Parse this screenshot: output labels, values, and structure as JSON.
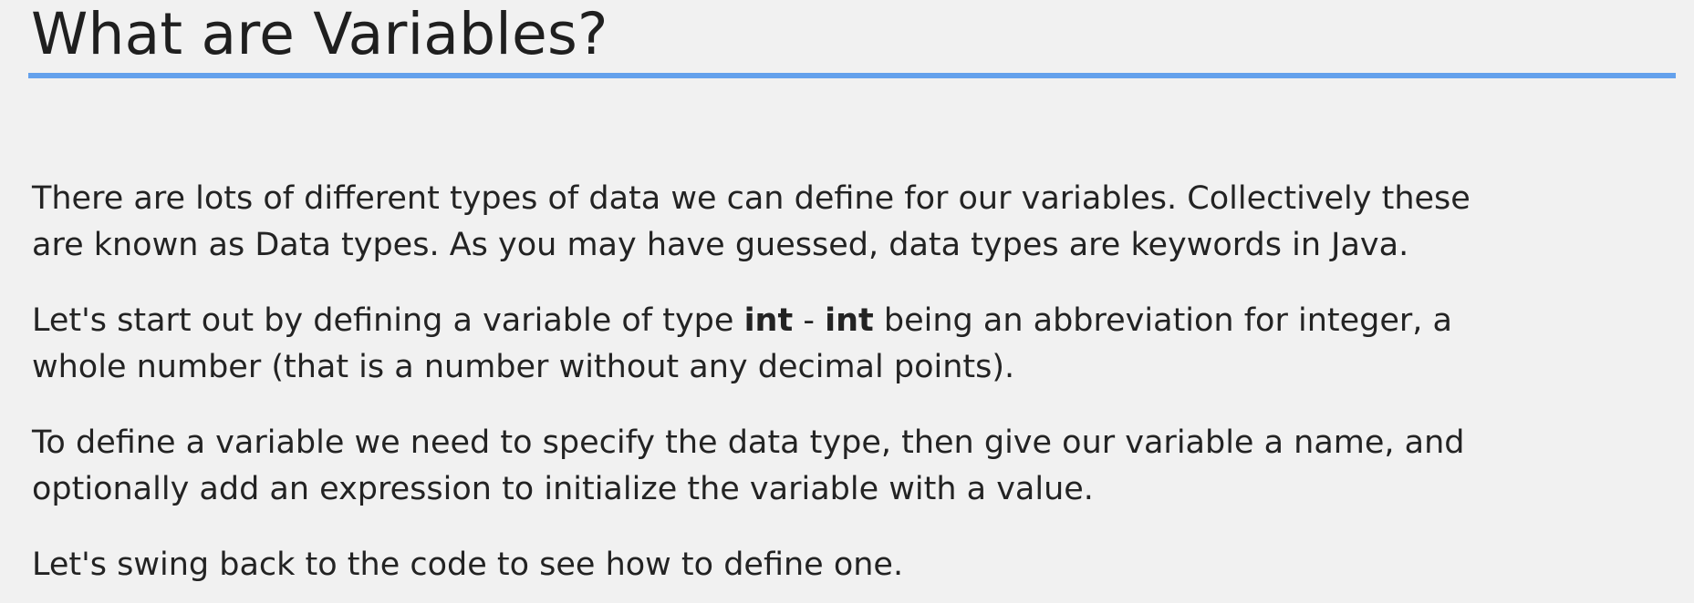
{
  "slide": {
    "title": "What are Variables?",
    "accent_color": "#64a1ec",
    "paragraphs": [
      {
        "lines": [
          "There are lots of different types of data we can define for our variables.  Collectively these",
          "are known as Data types. As you may have guessed, data types are keywords in Java."
        ]
      },
      {
        "line1": {
          "before": "Let's start out by defining a variable of type ",
          "keyword1": "int",
          "middle": " - ",
          "keyword2": "int",
          "after": " being an abbreviation for integer, a"
        },
        "line2": "whole number (that is a number without any decimal points)."
      },
      {
        "lines": [
          "To define a variable we need to specify the data type, then give our variable a name, and",
          "optionally add an expression to initialize the variable with a value."
        ]
      },
      {
        "lines": [
          "Let's swing back to the code to see how to define one."
        ]
      }
    ]
  }
}
